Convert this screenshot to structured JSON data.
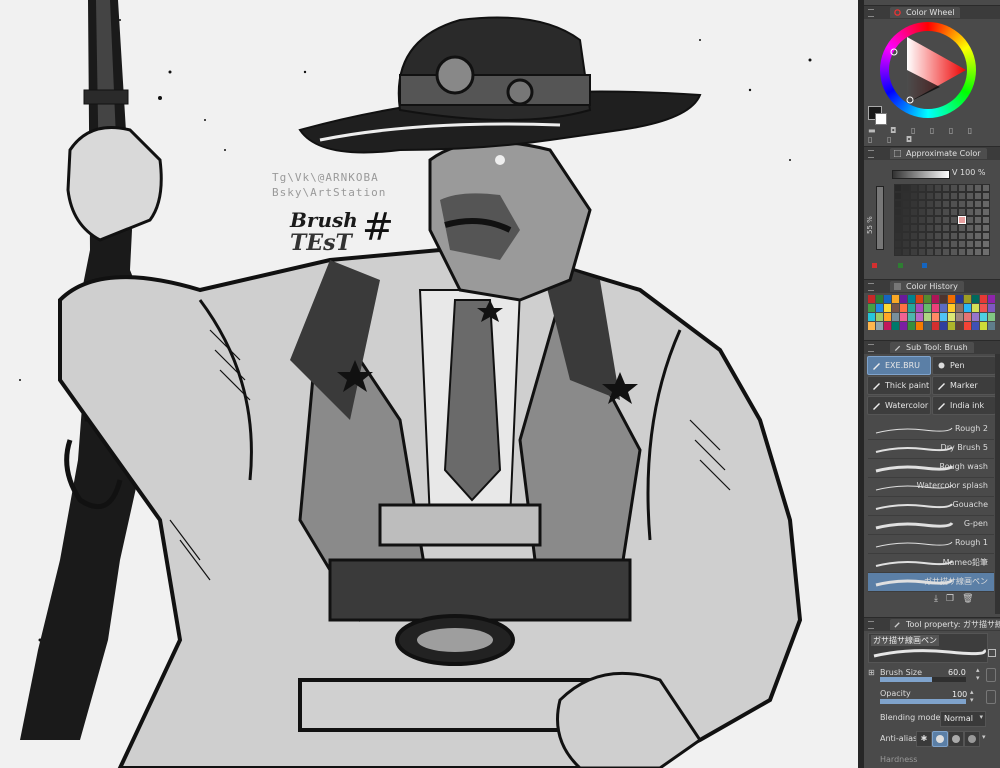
{
  "canvas": {
    "watermark_line1": "Tg\\Vk\\@ARNKOBA",
    "watermark_line2": "Bsky\\ArtStation",
    "title_word1": "Brush",
    "title_word2": "TEsT",
    "title_hash": "#"
  },
  "color_wheel": {
    "tab_label": "Color Wheel",
    "main_color": "#1a1a1a",
    "sub_color": "#ffffff"
  },
  "approx_color": {
    "tab_label": "Approximate Color",
    "value_label": "V 100 %",
    "slider_value": "55 %"
  },
  "color_history": {
    "tab_label": "Color History",
    "swatches": [
      "#c62828",
      "#2e7d32",
      "#1565c0",
      "#f9a825",
      "#6a1b9a",
      "#00838f",
      "#d84315",
      "#558b2f",
      "#ad1457",
      "#4e342e",
      "#ef6c00",
      "#283593",
      "#9e9d24",
      "#00695c",
      "#e53935",
      "#8e24aa",
      "#43a047",
      "#1e88e5",
      "#fdd835",
      "#795548",
      "#ff7043",
      "#26a69a",
      "#ab47bc",
      "#66bb6a",
      "#ec407a",
      "#5c6bc0",
      "#ffca28",
      "#8d6e63",
      "#29b6f6",
      "#d4e157",
      "#ef5350",
      "#7e57c2",
      "#26c6da",
      "#9ccc65",
      "#ffa726",
      "#78909c",
      "#f06292",
      "#4db6ac",
      "#ba68c8",
      "#aed581",
      "#ff8a65",
      "#4fc3f7",
      "#dce775",
      "#a1887f",
      "#e57373",
      "#9575cd",
      "#4dd0e1",
      "#81c784",
      "#ffb74d",
      "#90a4ae",
      "#c2185b",
      "#00796b",
      "#7b1fa2",
      "#388e3c",
      "#f57c00",
      "#455a64",
      "#d32f2f",
      "#303f9f",
      "#afb42b",
      "#5d4037",
      "#f44336",
      "#3f51b5",
      "#cddc39",
      "#607d8b"
    ]
  },
  "sub_tool": {
    "tab_label": "Sub Tool: Brush",
    "tools": [
      {
        "label": "EXE.BRU",
        "icon": "brush-icon"
      },
      {
        "label": "Pen",
        "icon": "pen-icon"
      },
      {
        "label": "Thick paint",
        "icon": "thick-paint-icon"
      },
      {
        "label": "Marker",
        "icon": "marker-icon"
      },
      {
        "label": "Watercolor",
        "icon": "watercolor-icon"
      },
      {
        "label": "India ink",
        "icon": "india-ink-icon"
      }
    ],
    "brushes": [
      "Rough 2",
      "Dry Brush 5",
      "Rough wash",
      "Watercolor splash",
      "Gouache",
      "G-pen",
      "Rough 1",
      "Mameo鉛筆",
      "ガサ描サ線画ペン"
    ]
  },
  "tool_property": {
    "tab_label": "Tool property: ガサ描サ線",
    "preview_label": "ガサ描サ線画ペン",
    "brush_size_label": "Brush Size",
    "brush_size_value": "60.0",
    "opacity_label": "Opacity",
    "opacity_value": "100",
    "blending_label": "Blending mode",
    "blending_value": "Normal",
    "antialias_label": "Anti-alias",
    "hardness_label": "Hardness",
    "opacity_fraction": 1.0,
    "brush_size_fraction": 0.6
  }
}
